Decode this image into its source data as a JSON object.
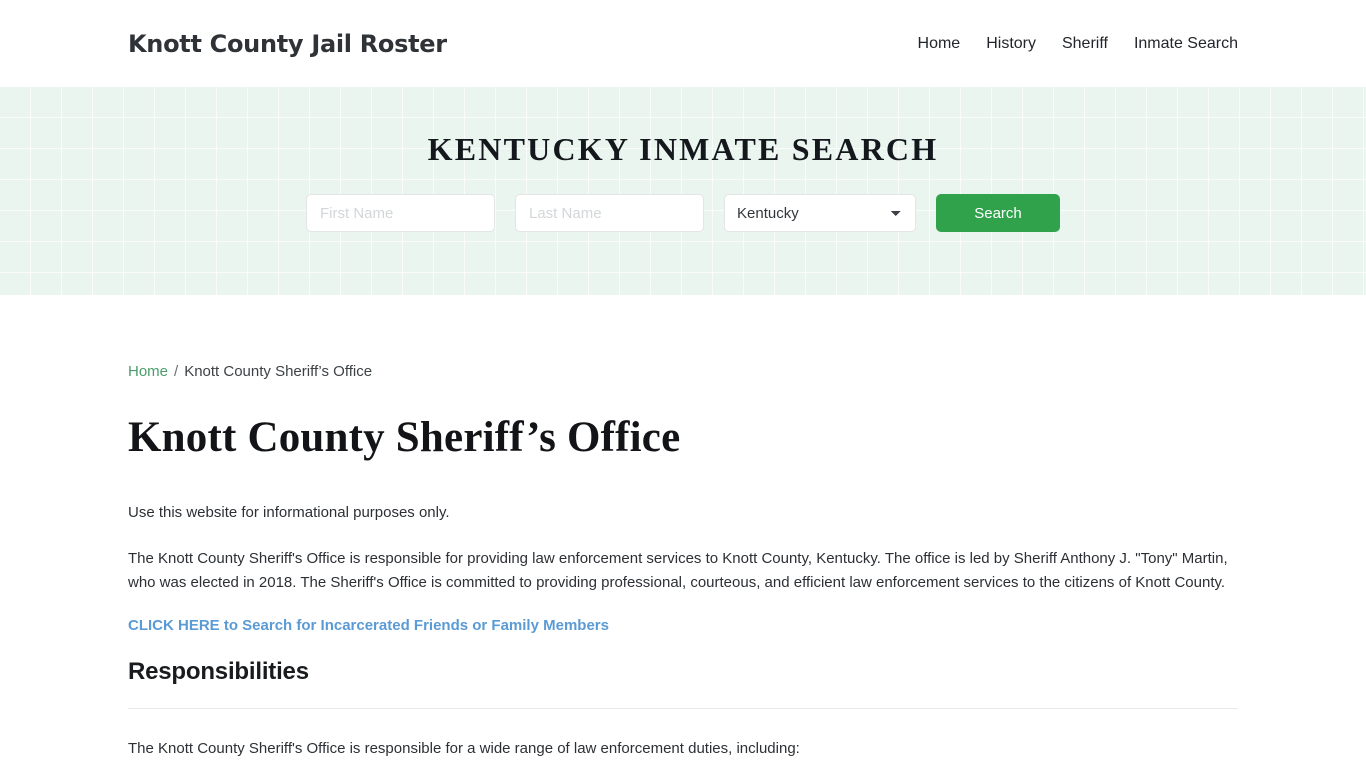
{
  "header": {
    "brand": "Knott County Jail Roster",
    "nav": [
      {
        "label": "Home"
      },
      {
        "label": "History"
      },
      {
        "label": "Sheriff"
      },
      {
        "label": "Inmate Search"
      }
    ]
  },
  "hero": {
    "title": "KENTUCKY INMATE SEARCH",
    "first_name_placeholder": "First Name",
    "first_name_value": "",
    "last_name_placeholder": "Last Name",
    "last_name_value": "",
    "state_selected": "Kentucky",
    "state_options": [
      "Kentucky"
    ],
    "search_label": "Search",
    "accent_color": "#31a24c",
    "background_color": "#eaf5ef"
  },
  "breadcrumb": {
    "home_label": "Home",
    "separator": "/",
    "current": "Knott County Sheriff’s Office"
  },
  "main": {
    "page_title": "Knott County Sheriff’s Office",
    "intro": "Use this website for informational purposes only.",
    "description": "The Knott County Sheriff's Office is responsible for providing law enforcement services to Knott County, Kentucky. The office is led by Sheriff Anthony J. \"Tony\" Martin, who was elected in 2018. The Sheriff's Office is committed to providing professional, courteous, and efficient law enforcement services to the citizens of Knott County.",
    "cta_link": "CLICK HERE to Search for Incarcerated Friends or Family Members",
    "cta_color": "#5b9bd5",
    "section_heading": "Responsibilities",
    "duties_intro": "The Knott County Sheriff's Office is responsible for a wide range of law enforcement duties, including:"
  }
}
